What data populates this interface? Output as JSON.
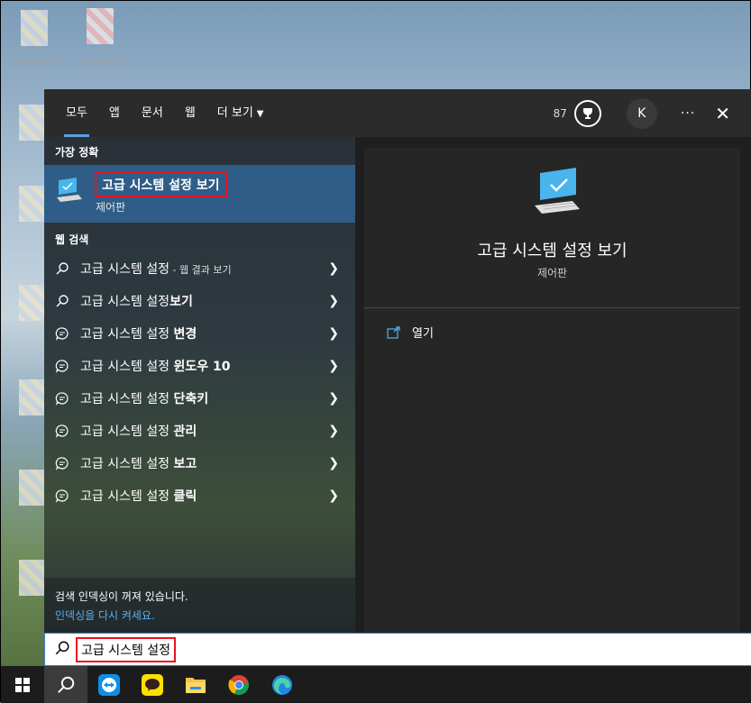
{
  "tabs": [
    {
      "label": "모두",
      "active": true
    },
    {
      "label": "앱"
    },
    {
      "label": "문서"
    },
    {
      "label": "웹"
    },
    {
      "label": "더 보기"
    }
  ],
  "header": {
    "points": "87",
    "avatar_initial": "K",
    "more": "···",
    "close": "✕"
  },
  "best_match": {
    "section": "가장 정확",
    "title": "고급 시스템 설정 보기",
    "subtitle": "제어판"
  },
  "web_search": {
    "section": "웹 검색",
    "items": [
      {
        "prefix": "고급 시스템 설정",
        "bold": "",
        "suffix": " - 웹 결과 보기",
        "icon": "search-icon"
      },
      {
        "prefix": "고급 시스템 설정",
        "bold": "보기",
        "suffix": "",
        "icon": "search-icon"
      },
      {
        "prefix": "고급 시스템 설정 ",
        "bold": "변경",
        "suffix": "",
        "icon": "chat-search-icon"
      },
      {
        "prefix": "고급 시스템 설정 ",
        "bold": "윈도우 10",
        "suffix": "",
        "icon": "chat-search-icon"
      },
      {
        "prefix": "고급 시스템 설정 ",
        "bold": "단축키",
        "suffix": "",
        "icon": "chat-search-icon"
      },
      {
        "prefix": "고급 시스템 설정 ",
        "bold": "관리",
        "suffix": "",
        "icon": "chat-search-icon"
      },
      {
        "prefix": "고급 시스템 설정 ",
        "bold": "보고",
        "suffix": "",
        "icon": "chat-search-icon"
      },
      {
        "prefix": "고급 시스템 설정 ",
        "bold": "클릭",
        "suffix": "",
        "icon": "chat-search-icon"
      }
    ]
  },
  "indexing": {
    "message": "검색 인덱싱이 꺼져 있습니다.",
    "link": "인덱싱을 다시 켜세요."
  },
  "preview": {
    "title": "고급 시스템 설정 보기",
    "subtitle": "제어판",
    "open_label": "열기"
  },
  "search": {
    "value": "고급 시스템 설정"
  },
  "colors": {
    "accent": "#2f5d87",
    "highlight_box": "#e81123",
    "link": "#5ab0f0"
  }
}
